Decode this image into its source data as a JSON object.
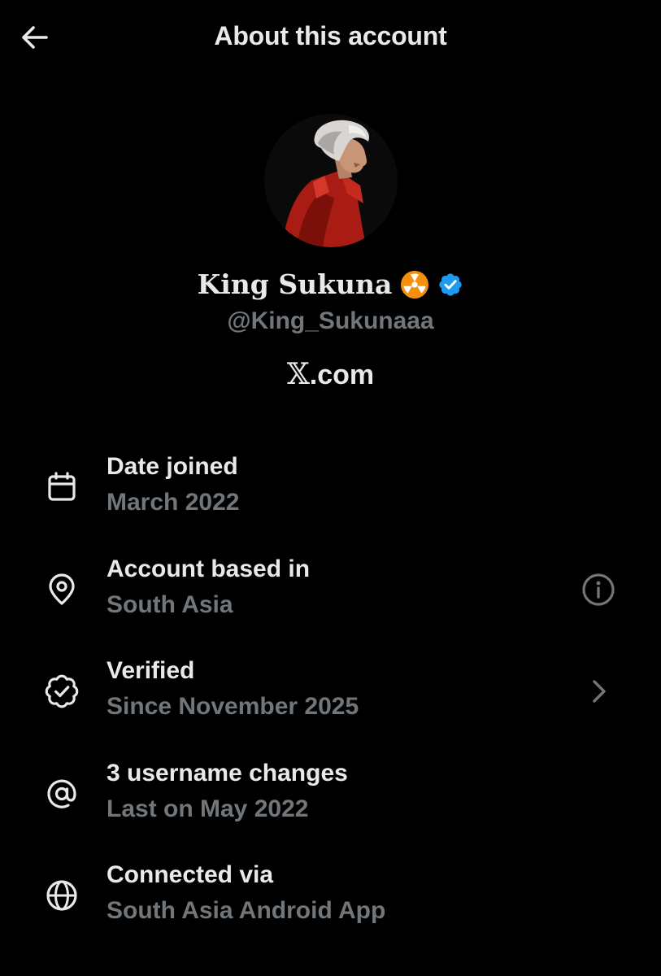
{
  "header": {
    "title": "About this account",
    "back_icon": "arrow-left-icon"
  },
  "profile": {
    "display_name": "King Sukuna",
    "name_emoji": "radioactive-emoji",
    "verified_badge": "verified-badge-icon",
    "badge_color": "#1d9bf0",
    "handle": "@King_Sukunaaa",
    "site_prefix": "𝕏",
    "site_suffix": ".com"
  },
  "details": [
    {
      "icon": "calendar-icon",
      "label": "Date joined",
      "value": "March 2022"
    },
    {
      "icon": "location-pin-icon",
      "label": "Account based in",
      "value": "South Asia",
      "action_icon": "info-icon"
    },
    {
      "icon": "verified-outline-icon",
      "label": "Verified",
      "value": "Since November 2025",
      "action_icon": "chevron-right-icon"
    },
    {
      "icon": "at-sign-icon",
      "label": "3 username changes",
      "value": "Last on May 2022"
    },
    {
      "icon": "globe-icon",
      "label": "Connected via",
      "value": "South Asia Android App"
    }
  ],
  "colors": {
    "background": "#000000",
    "primary_text": "#e7e9ea",
    "secondary_text": "#71767b"
  }
}
